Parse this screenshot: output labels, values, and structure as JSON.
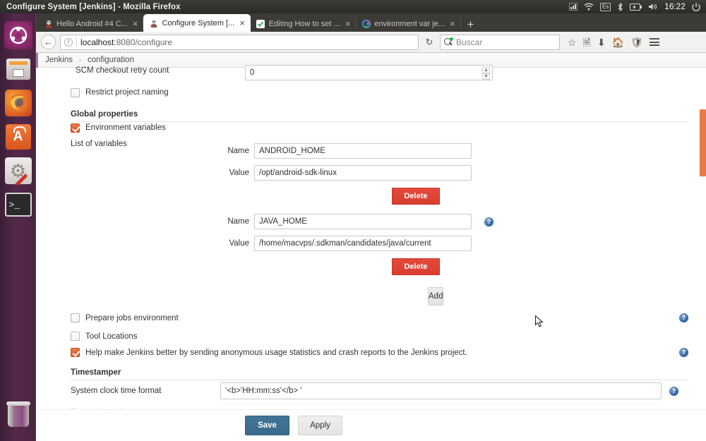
{
  "window": {
    "title": "Configure System [Jenkins] - Mozilla Firefox"
  },
  "tray": {
    "network_icon": "network-icon",
    "wifi_icon": "wifi-icon",
    "keyboard_label": "Es",
    "bluetooth_icon": "bluetooth-icon",
    "battery_icon": "battery-icon",
    "volume_icon": "volume-icon",
    "clock": "16:22",
    "power_icon": "power-icon"
  },
  "launcher": {
    "items": [
      {
        "name": "ubuntu-dash",
        "label": "Dash home"
      },
      {
        "name": "files",
        "label": "Files"
      },
      {
        "name": "firefox",
        "label": "Firefox"
      },
      {
        "name": "software-center",
        "label": "Ubuntu Software"
      },
      {
        "name": "system-settings",
        "label": "System Settings"
      },
      {
        "name": "terminal",
        "label": "Terminal"
      }
    ],
    "trash_label": "Trash"
  },
  "browser": {
    "tabs": [
      {
        "label": "Hello Android #4 C...",
        "favicon": "jenkins-icon",
        "active": false,
        "close_label": "×"
      },
      {
        "label": "Configure System [...",
        "favicon": "jenkins-icon",
        "active": true,
        "close_label": "×"
      },
      {
        "label": "Editing How to set ...",
        "favicon": "github-icon",
        "active": false,
        "close_label": "×"
      },
      {
        "label": "environment var je...",
        "favicon": "google-icon",
        "active": false,
        "close_label": "×"
      }
    ],
    "new_tab_label": "+",
    "url_host": "localhost",
    "url_path": ":8080/configure",
    "search_placeholder": "Buscar",
    "back_icon": "back-arrow-icon",
    "reload_icon": "reload-icon",
    "bookmark_icon": "star-icon",
    "library_icon": "library-icon",
    "downloads_icon": "download-icon",
    "home_icon": "home-icon",
    "shield_icon": "shield-icon",
    "menu_icon": "hamburger-menu-icon"
  },
  "jenkins": {
    "breadcrumbs": [
      {
        "label": "Jenkins"
      },
      {
        "label": "configuration"
      }
    ],
    "breadcrumb_separator": "›",
    "scm_retry": {
      "label": "SCM checkout retry count",
      "value": "0"
    },
    "restrict_naming": {
      "label": "Restrict project naming",
      "checked": false
    },
    "global_properties": {
      "title": "Global properties",
      "env_vars_label": "Environment variables",
      "env_vars_checked": true,
      "list_label": "List of variables",
      "name_label": "Name",
      "value_label": "Value",
      "delete_label": "Delete",
      "add_label": "Add",
      "variables": [
        {
          "name": "ANDROID_HOME",
          "value": "/opt/android-sdk-linux"
        },
        {
          "name": "JAVA_HOME",
          "value": "/home/macvps/.sdkman/candidates/java/current"
        }
      ]
    },
    "options": [
      {
        "label": "Prepare jobs environment",
        "checked": false,
        "help": true
      },
      {
        "label": "Tool Locations",
        "checked": false,
        "help": false
      },
      {
        "label": "Help make Jenkins better by sending anonymous usage statistics and crash reports to the Jenkins project.",
        "checked": true,
        "help": true
      }
    ],
    "timestamper": {
      "title": "Timestamper",
      "clock_format_label": "System clock time format",
      "clock_format_value": "'<b>'HH:mm:ss'</b> '",
      "elapsed_label": "Elapsed time format"
    },
    "buttons": {
      "save": "Save",
      "apply": "Apply"
    },
    "help_icon_label": "?"
  },
  "colors": {
    "jenkins_delete_red": "#d93d2d",
    "jenkins_save_blue": "#3a6a8b",
    "checkbox_orange": "#d9542a",
    "scrollbar_orange": "#e8774a",
    "launcher_purple": "#55294b"
  }
}
